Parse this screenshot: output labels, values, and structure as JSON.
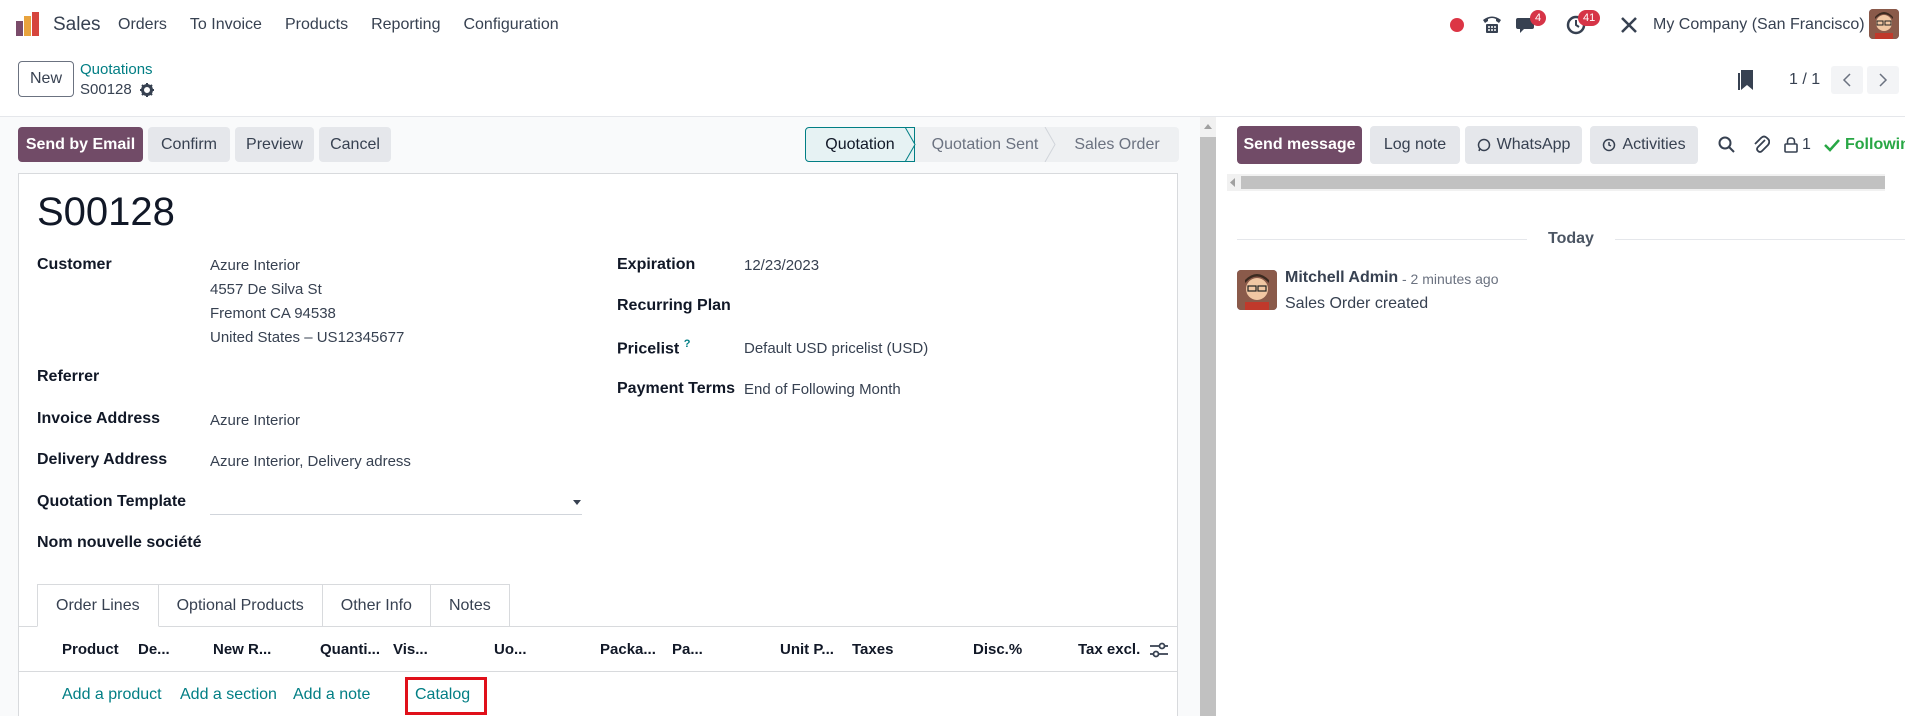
{
  "navbar": {
    "app_name": "Sales",
    "menu": [
      "Orders",
      "To Invoice",
      "Products",
      "Reporting",
      "Configuration"
    ],
    "chat_count": "4",
    "activity_count": "41",
    "company": "My Company (San Francisco)"
  },
  "control": {
    "new_label": "New",
    "breadcrumb_parent": "Quotations",
    "breadcrumb_current": "S00128",
    "pager": "1 / 1"
  },
  "statusbar": {
    "buttons": [
      "Send by Email",
      "Confirm",
      "Preview",
      "Cancel"
    ],
    "stages": [
      "Quotation",
      "Quotation Sent",
      "Sales Order"
    ],
    "active_stage": "Quotation"
  },
  "form": {
    "name": "S00128",
    "customer_label": "Customer",
    "customer_lines": [
      "Azure Interior",
      "4557 De Silva St",
      "Fremont CA 94538",
      "United States – US12345677"
    ],
    "referrer_label": "Referrer",
    "invoice_label": "Invoice Address",
    "invoice_value": "Azure Interior",
    "delivery_label": "Delivery Address",
    "delivery_value": "Azure Interior, Delivery adress",
    "template_label": "Quotation Template",
    "nom_label": "Nom nouvelle société",
    "expiration_label": "Expiration",
    "expiration_value": "12/23/2023",
    "recurring_label": "Recurring Plan",
    "pricelist_label": "Pricelist",
    "pricelist_help": "?",
    "pricelist_value": "Default USD pricelist (USD)",
    "payment_label": "Payment Terms",
    "payment_value": "End of Following Month"
  },
  "tabs": [
    "Order Lines",
    "Optional Products",
    "Other Info",
    "Notes"
  ],
  "columns": [
    "Product",
    "De...",
    "New R...",
    "Quanti...",
    "Vis...",
    "Uo...",
    "Packa...",
    "Pa...",
    "Unit P...",
    "Taxes",
    "Disc.%",
    "Tax excl."
  ],
  "add_links": [
    "Add a product",
    "Add a section",
    "Add a note",
    "Catalog"
  ],
  "chatter": {
    "send_message": "Send message",
    "log_note": "Log note",
    "whatsapp": "WhatsApp",
    "activities": "Activities",
    "followers_count": "1",
    "following": "Following",
    "today": "Today",
    "author": "Mitchell Admin",
    "time": "- 2 minutes ago",
    "body": "Sales Order created"
  },
  "colors": {
    "primary": "#714b67",
    "link": "#017e84",
    "highlight": "#e0101a"
  }
}
